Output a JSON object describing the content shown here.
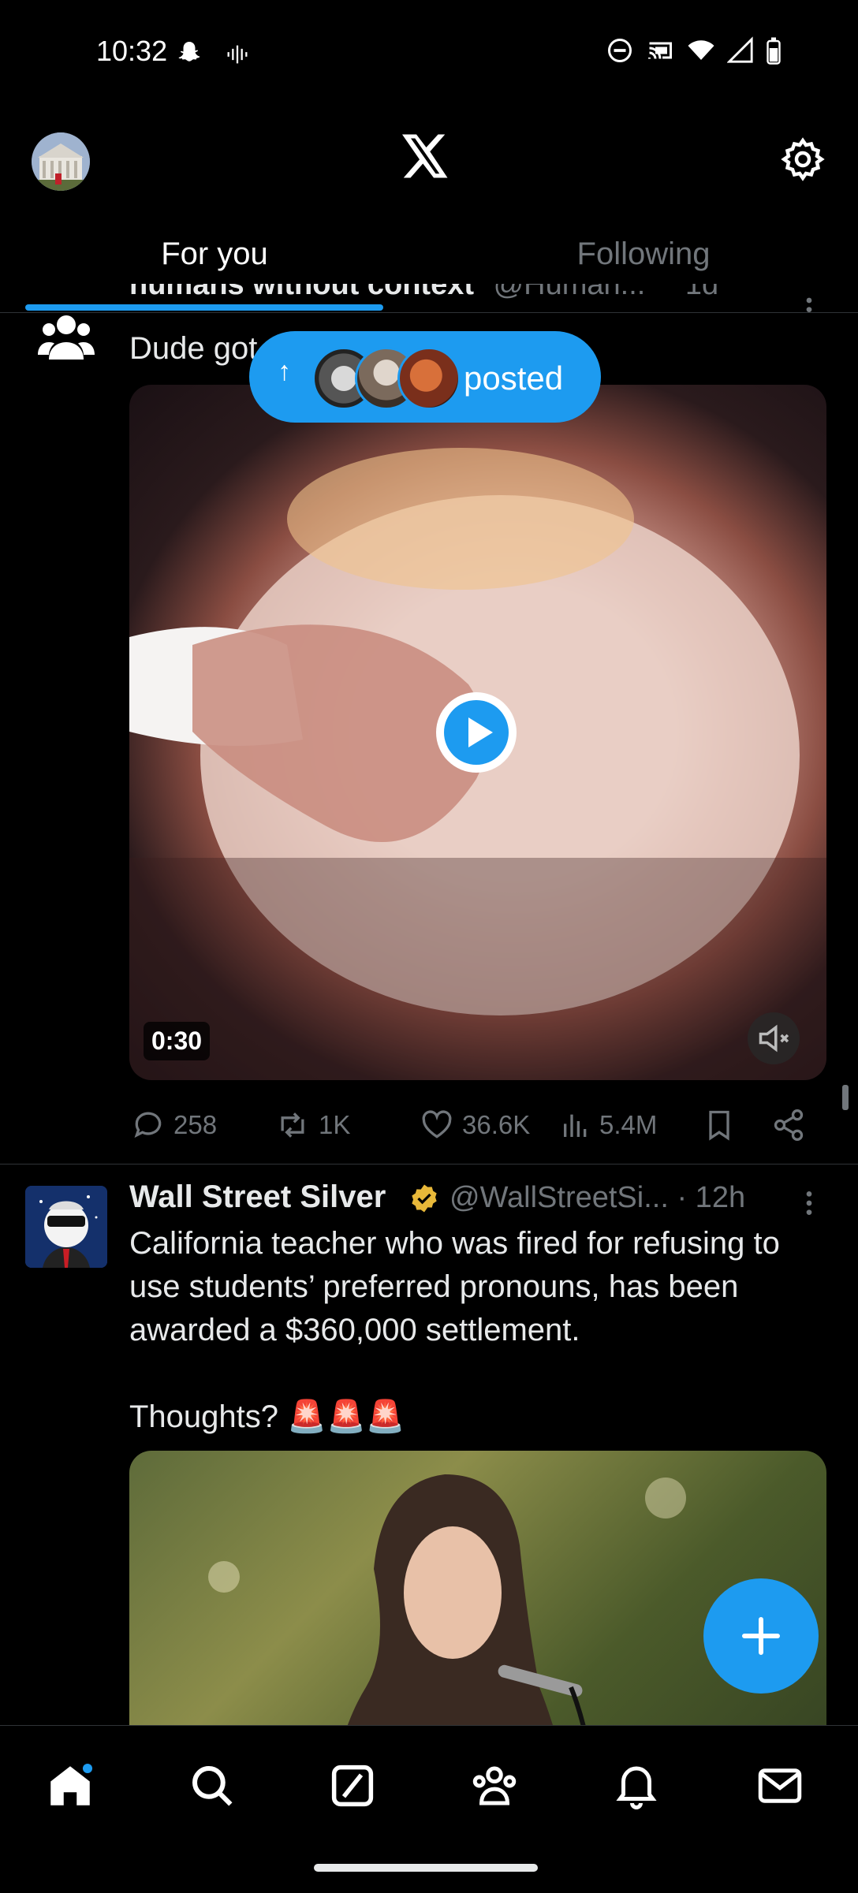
{
  "status_bar": {
    "time": "10:32"
  },
  "header": {
    "logo": "X"
  },
  "tabs": [
    {
      "label": "For you",
      "active": true
    },
    {
      "label": "Following",
      "active": false
    }
  ],
  "new_posts_pill": {
    "label": "posted"
  },
  "post1": {
    "author_partial": "humans without context",
    "handle_partial": "@Human...",
    "time_partial": "1d",
    "text": "Dude got",
    "video_duration": "0:30",
    "stats": {
      "replies": "258",
      "reposts": "1K",
      "likes": "36.6K",
      "views": "5.4M"
    }
  },
  "post2": {
    "author": "Wall Street Silver",
    "handle": "@WallStreetSi...",
    "time": "· 12h",
    "text": "California teacher who was fired for refusing to use students’ preferred pronouns, has been awarded a $360,000 settlement.\n\nThoughts? 🚨🚨🚨"
  },
  "colors": {
    "accent": "#1d9bf0",
    "background": "#000000",
    "muted": "#71767b",
    "verified": "#e8b839"
  }
}
